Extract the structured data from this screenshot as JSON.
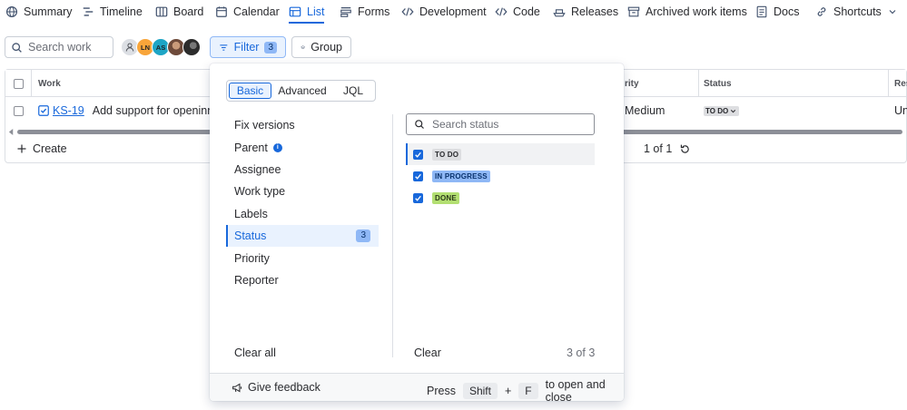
{
  "nav": {
    "tabs": [
      {
        "label": "Summary",
        "icon": "globe-icon"
      },
      {
        "label": "Timeline",
        "icon": "timeline-icon"
      },
      {
        "label": "Board",
        "icon": "board-icon"
      },
      {
        "label": "Calendar",
        "icon": "calendar-icon"
      },
      {
        "label": "List",
        "icon": "list-icon",
        "active": true
      },
      {
        "label": "Forms",
        "icon": "forms-icon"
      },
      {
        "label": "Development",
        "icon": "code-brackets-icon"
      },
      {
        "label": "Code",
        "icon": "code-icon"
      },
      {
        "label": "Releases",
        "icon": "ship-icon"
      },
      {
        "label": "Archived work items",
        "icon": "archive-icon"
      },
      {
        "label": "Docs",
        "icon": "docs-icon"
      },
      {
        "label": "Shortcuts",
        "icon": "link-icon"
      }
    ],
    "more_icon": "chevron-down-icon"
  },
  "toolbar": {
    "search_placeholder": "Search work",
    "avatars": [
      {
        "initials": "",
        "color": "#dcdfe4",
        "kind": "unassigned"
      },
      {
        "initials": "LN",
        "color": "#f8a53a"
      },
      {
        "initials": "AS",
        "color": "#1ea5c5"
      },
      {
        "initials": "",
        "color": "#6e4a3a",
        "kind": "photo"
      },
      {
        "initials": "",
        "color": "#2c2c2c",
        "kind": "photo"
      }
    ],
    "filter_label": "Filter",
    "filter_count": "3",
    "group_label": "Group"
  },
  "table": {
    "headers": {
      "work": "Work",
      "priority": "rity",
      "status": "Status",
      "resolution": "Res"
    },
    "row": {
      "key": "KS-19",
      "summary": "Add support for openinnew",
      "priority": "Medium",
      "status": "TO DO",
      "resolution": "Unr"
    },
    "create_label": "Create",
    "pager": "1 of 1"
  },
  "filter_popup": {
    "modes": [
      "Basic",
      "Advanced",
      "JQL"
    ],
    "active_mode": "Basic",
    "fields": [
      {
        "label": "Fix versions"
      },
      {
        "label": "Parent",
        "info": true
      },
      {
        "label": "Assignee"
      },
      {
        "label": "Work type"
      },
      {
        "label": "Labels"
      },
      {
        "label": "Status",
        "active": true,
        "count": "3"
      },
      {
        "label": "Priority"
      },
      {
        "label": "Reporter"
      }
    ],
    "clear_all": "Clear all",
    "status_search_placeholder": "Search status",
    "options": [
      {
        "label": "TO DO",
        "checked": true,
        "bg": "#dddee1",
        "fg": "#292a2e"
      },
      {
        "label": "IN PROGRESS",
        "checked": true,
        "bg": "#8fb8f6",
        "fg": "#09326c"
      },
      {
        "label": "DONE",
        "checked": true,
        "bg": "#b3df72",
        "fg": "#2a3818"
      }
    ],
    "clear": "Clear",
    "counter": "3 of 3",
    "footer": {
      "feedback": "Give feedback",
      "press": "Press",
      "key1": "Shift",
      "plus": "+",
      "key2": "F",
      "suffix": "to open and close"
    }
  },
  "colors": {
    "accent": "#1868db",
    "accent_bg": "#e9f2fe"
  }
}
